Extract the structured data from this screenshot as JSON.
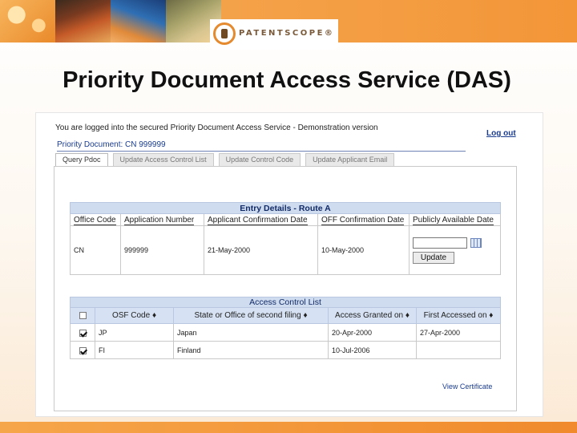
{
  "slide": {
    "title": "Priority Document Access Service (DAS)"
  },
  "logo": {
    "text": "PATENTSCOPE®"
  },
  "app": {
    "logged_in_message": "You are logged into the secured Priority Document Access Service - Demonstration version",
    "logout_label": "Log out",
    "priority_document": "Priority Document: CN 999999",
    "tabs": [
      {
        "label": "Query Pdoc",
        "active": true
      },
      {
        "label": "Update Access Control List",
        "active": false
      },
      {
        "label": "Update Control Code",
        "active": false
      },
      {
        "label": "Update Applicant Email",
        "active": false
      }
    ]
  },
  "entry_details": {
    "caption": "Entry Details - Route A",
    "headers": [
      "Office Code",
      "Application Number",
      "Applicant Confirmation Date",
      "OFF Confirmation Date",
      "Publicly Available Date"
    ],
    "row": {
      "office_code": "CN",
      "application_number": "999999",
      "applicant_confirmation_date": "21-May-2000",
      "off_confirmation_date": "10-May-2000",
      "publicly_available_date": ""
    },
    "update_label": "Update"
  },
  "access_control": {
    "caption": "Access Control List",
    "headers": [
      "",
      "OSF Code ♦",
      "State or Office of second filing ♦",
      "Access Granted on ♦",
      "First Accessed on ♦"
    ],
    "rows": [
      {
        "checked": true,
        "osf_code": "JP",
        "state": "Japan",
        "granted": "20-Apr-2000",
        "first_accessed": "27-Apr-2000"
      },
      {
        "checked": true,
        "osf_code": "FI",
        "state": "Finland",
        "granted": "10-Jul-2006",
        "first_accessed": ""
      }
    ],
    "view_certificate_label": "View Certificate"
  },
  "colors": {
    "banner_orange": "#f39435",
    "table_header_blue": "#cfdcf0",
    "link_blue": "#1a3c8f"
  }
}
